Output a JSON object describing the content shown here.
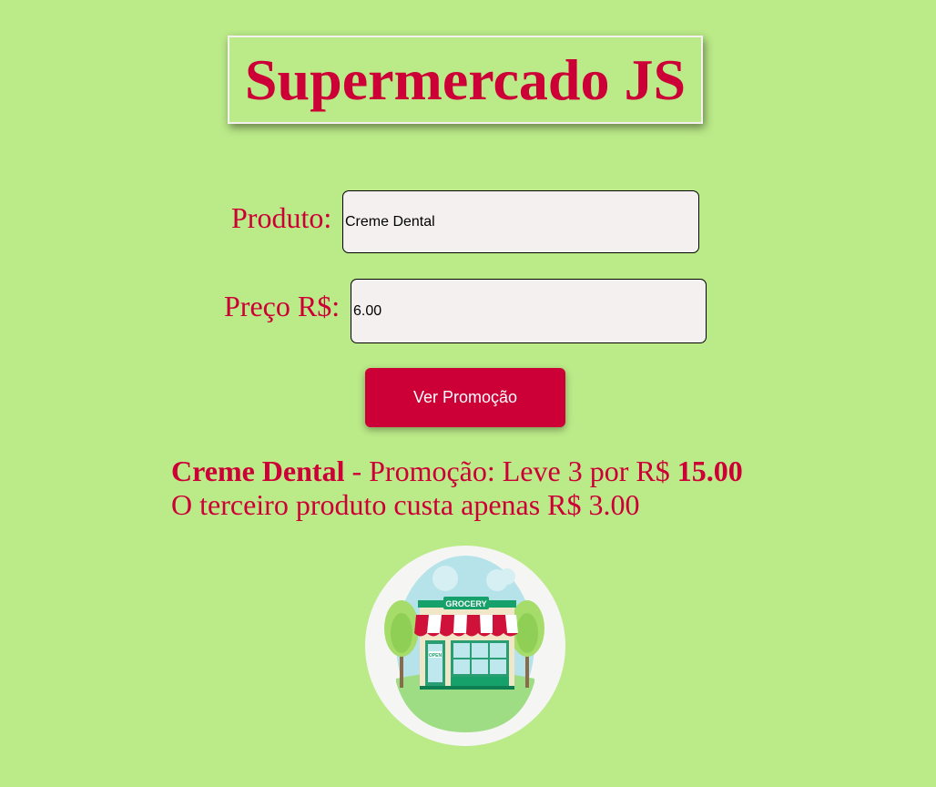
{
  "header": {
    "title": "Supermercado JS"
  },
  "form": {
    "product_label": "Produto:",
    "product_value": "Creme Dental",
    "price_label": "Preço R$:",
    "price_value": "6.00",
    "submit_label": "Ver Promoção"
  },
  "result": {
    "product_name": "Creme Dental",
    "promo_text": " - Promoção: Leve 3 por R$ ",
    "promo_total": "15.00",
    "third_product_text": "O terceiro produto custa apenas R$ 3.00"
  },
  "image": {
    "sign_text": "GROCERY",
    "door_sign_text": "OPEN"
  },
  "colors": {
    "background": "#bbea88",
    "accent": "#cc0036",
    "input_background": "#f4f0f0"
  }
}
